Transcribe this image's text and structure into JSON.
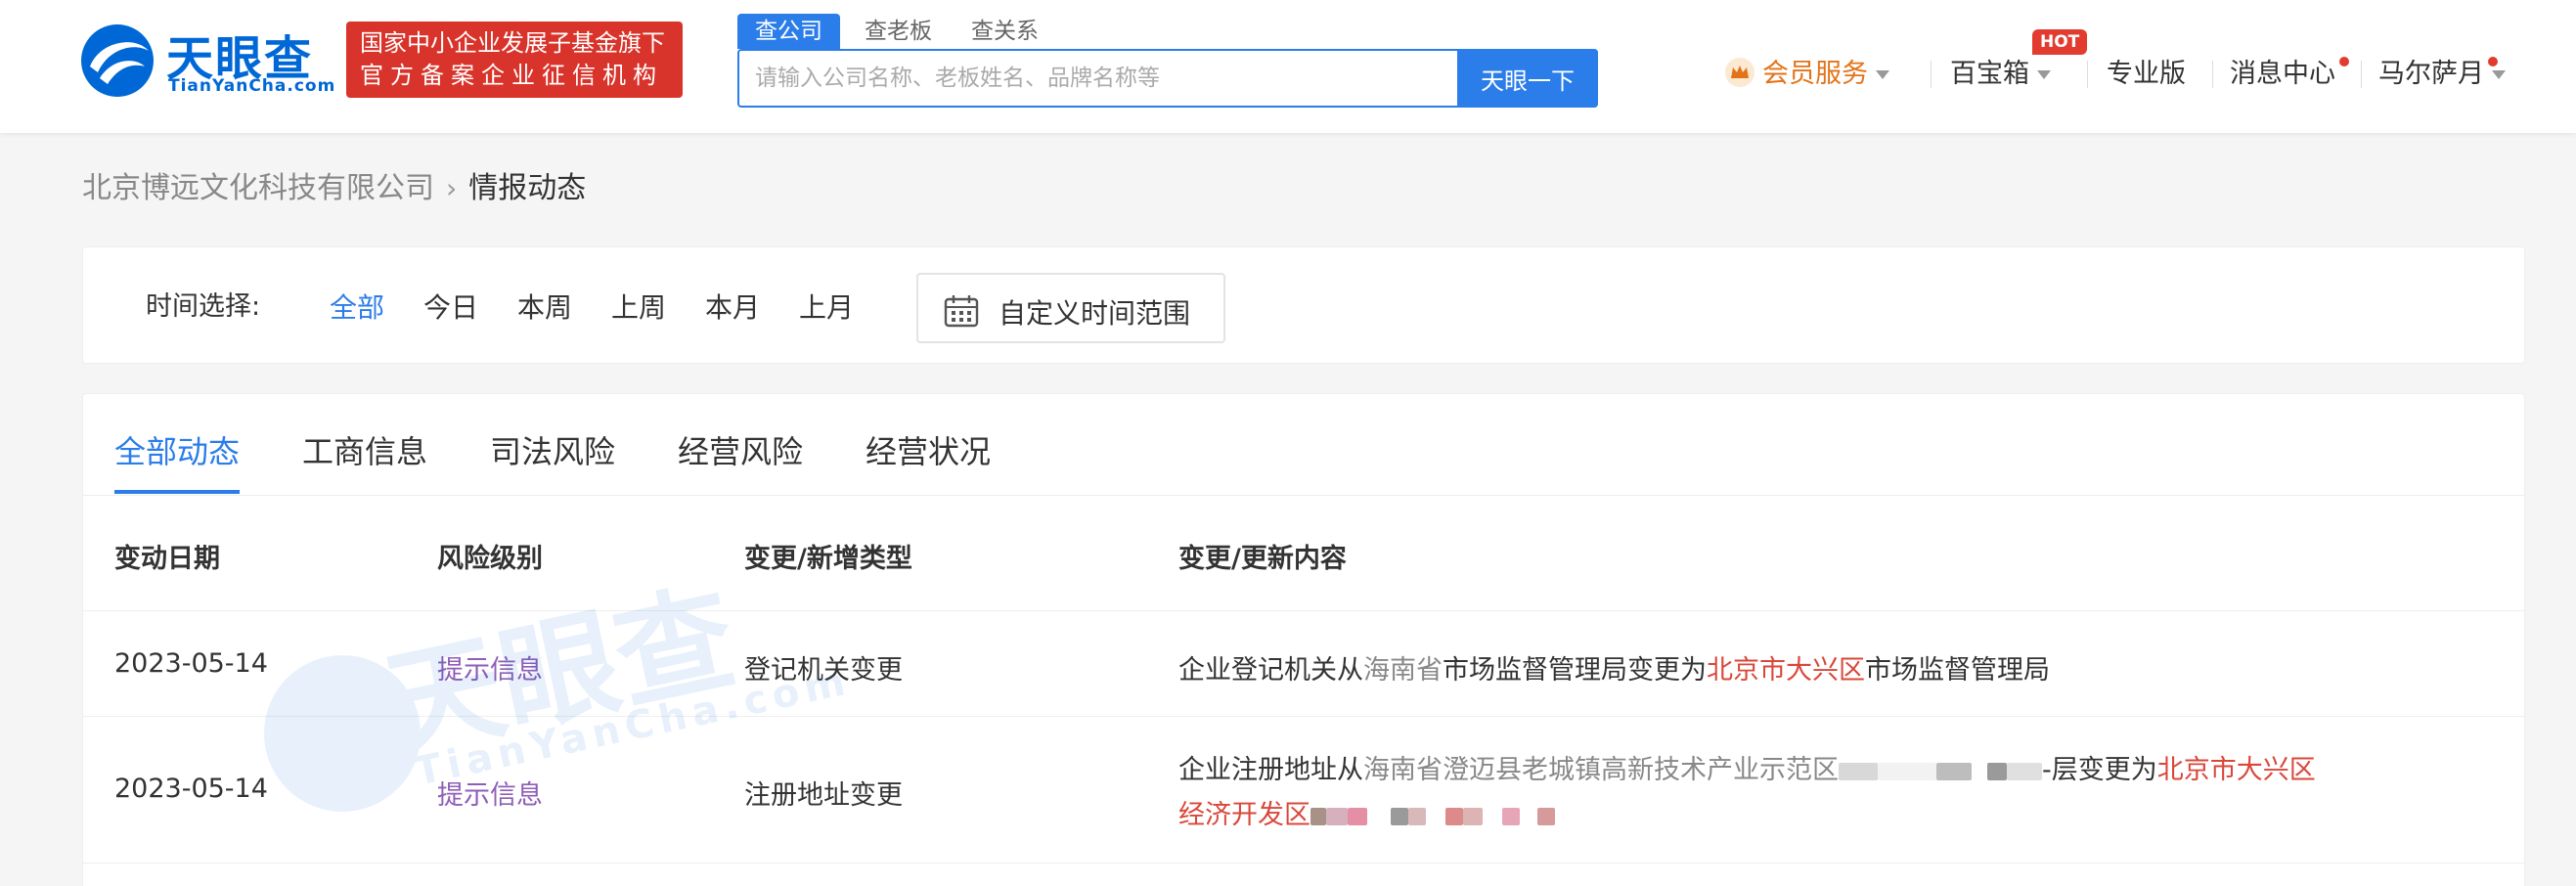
{
  "header": {
    "logo_text": "天眼查",
    "logo_sub": "TianYanCha.com",
    "badge_line1": "国家中小企业发展子基金旗下",
    "badge_line2": "官方备案企业征信机构",
    "search_tabs": [
      "查公司",
      "查老板",
      "查关系"
    ],
    "search_placeholder": "请输入公司名称、老板姓名、品牌名称等",
    "search_button": "天眼一下",
    "nav": {
      "member": "会员服务",
      "treasure": "百宝箱",
      "hot_badge": "HOT",
      "pro": "专业版",
      "messages": "消息中心",
      "user": "马尔萨月"
    }
  },
  "breadcrumb": {
    "company": "北京博远文化科技有限公司",
    "current": "情报动态"
  },
  "time_filter": {
    "label": "时间选择:",
    "options": [
      "全部",
      "今日",
      "本周",
      "上周",
      "本月",
      "上月"
    ],
    "custom": "自定义时间范围"
  },
  "tabs": [
    "全部动态",
    "工商信息",
    "司法风险",
    "经营风险",
    "经营状况"
  ],
  "table": {
    "headers": [
      "变动日期",
      "风险级别",
      "变更/新增类型",
      "变更/更新内容"
    ],
    "rows": [
      {
        "date": "2023-05-14",
        "risk": "提示信息",
        "type": "登记机关变更",
        "content": {
          "p1": "企业登记机关从",
          "from": "海南省",
          "p2": "市场监督管理局变更为",
          "to": "北京市大兴区",
          "p3": "市场监督管理局"
        }
      },
      {
        "date": "2023-05-14",
        "risk": "提示信息",
        "type": "注册地址变更",
        "content": {
          "p1": "企业注册地址从",
          "from": "海南省澄迈县老城镇高新技术产业示范区",
          "p2": "-层变更为",
          "to_line1": "北京市大兴区",
          "to_line2": "经济开发区"
        }
      }
    ]
  },
  "watermark": {
    "text": "天眼查",
    "sub": "TianYanCha.com"
  },
  "colors": {
    "brand_blue": "#2b7de9",
    "badge_red": "#d9342b",
    "risk_purple": "#8e5eb8",
    "highlight_red": "#d9473a"
  }
}
